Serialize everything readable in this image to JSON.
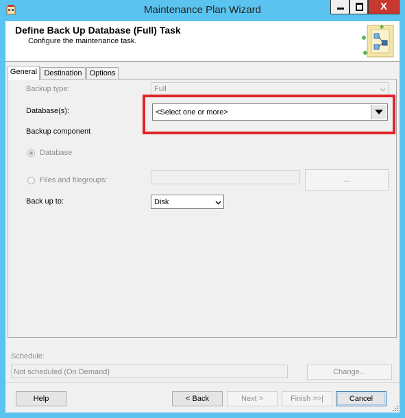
{
  "window": {
    "title": "Maintenance Plan Wizard",
    "controls": {
      "minimize_icon": "minimize-icon",
      "maximize_icon": "maximize-icon",
      "close_glyph": "X"
    }
  },
  "header": {
    "title": "Define Back Up Database (Full) Task",
    "subtitle": "Configure the maintenance task."
  },
  "tabs": [
    {
      "label": "General",
      "active": true
    },
    {
      "label": "Destination",
      "active": false
    },
    {
      "label": "Options",
      "active": false
    }
  ],
  "general": {
    "backup_type_label": "Backup type:",
    "backup_type_value": "Full",
    "databases_label": "Database(s):",
    "databases_value": "<Select one or more>",
    "backup_component_label": "Backup component",
    "radio_database_label": "Database",
    "radio_files_label": "Files and filegroups:",
    "files_browse_label": "...",
    "backup_to_label": "Back up to:",
    "backup_to_value": "Disk"
  },
  "schedule": {
    "label": "Schedule:",
    "value": "Not scheduled (On Demand)",
    "change_label": "Change..."
  },
  "footer": {
    "help_label": "Help",
    "back_label": "< Back",
    "next_label": "Next >",
    "finish_label": "Finish >>|",
    "cancel_label": "Cancel"
  },
  "colors": {
    "window_frame": "#5bc3ef",
    "highlight_box": "#e2222a",
    "close_button": "#c7382f"
  }
}
